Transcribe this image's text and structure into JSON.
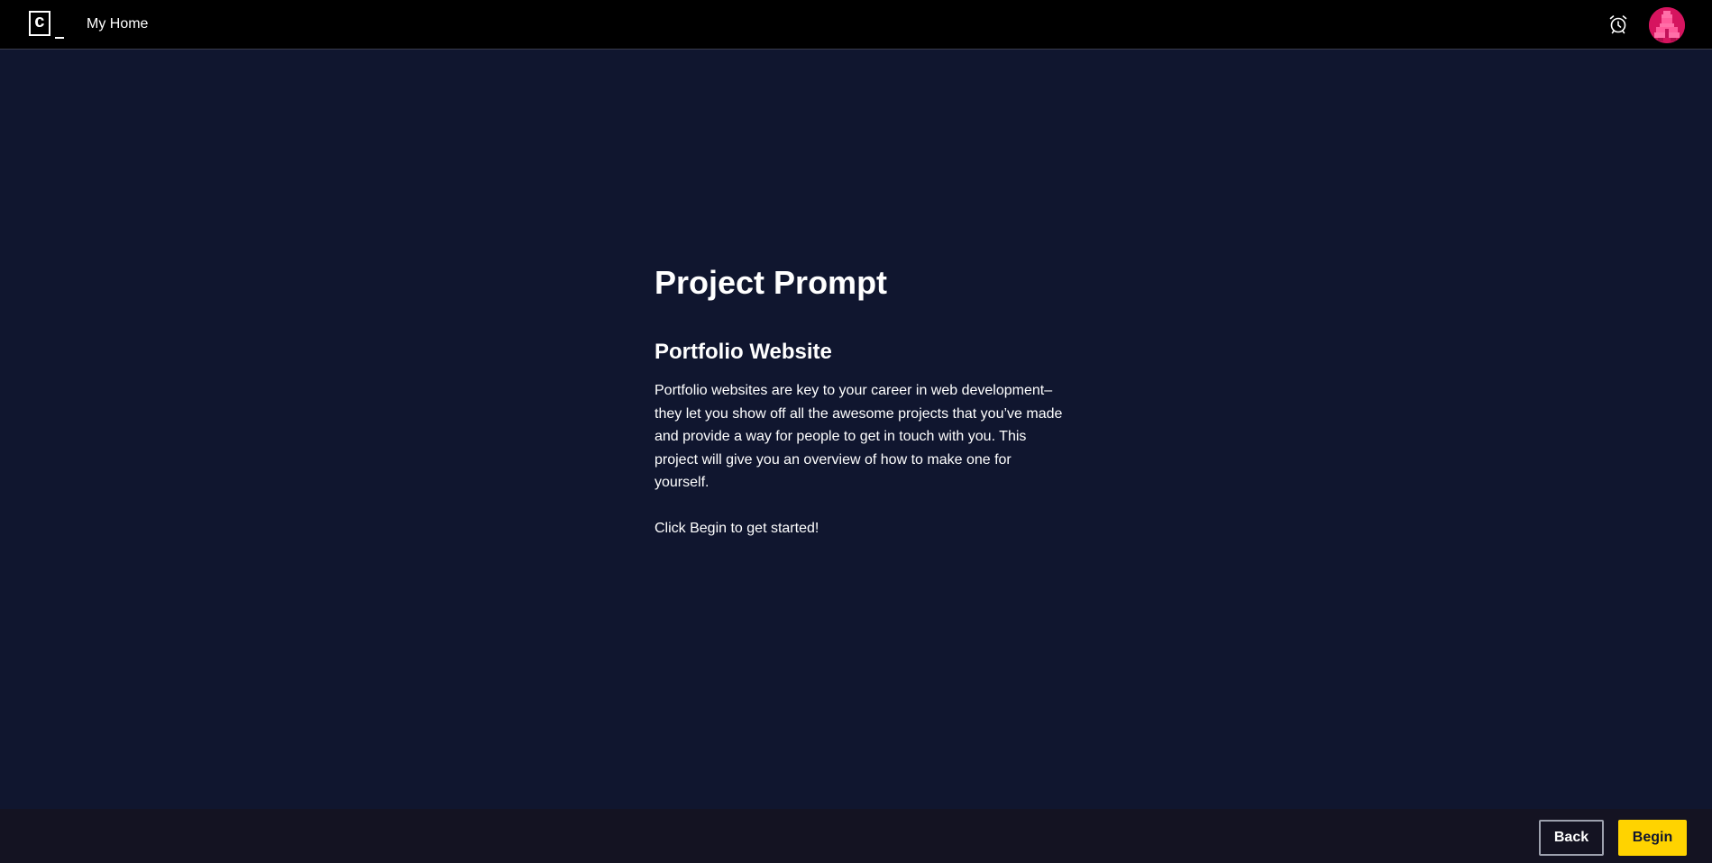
{
  "header": {
    "logo_text": "c",
    "home_label": "My Home",
    "alarm_icon": "alarm-clock-icon",
    "avatar_icon": "pixel-avatar",
    "avatar_color": "#d6145f"
  },
  "main": {
    "title": "Project Prompt",
    "project_name": "Portfolio Website",
    "description": "Portfolio websites are key to your career in web development–they let you show off all the awesome projects that you’ve made and provide a way for people to get in touch with you. This project will give you an overview of how to make one for yourself.",
    "cta": "Click Begin to get started!"
  },
  "footer": {
    "back_label": "Back",
    "begin_label": "Begin",
    "begin_color": "#ffd300"
  },
  "theme": {
    "background": "#10162f",
    "topbar": "#000000",
    "footer": "#141322"
  }
}
